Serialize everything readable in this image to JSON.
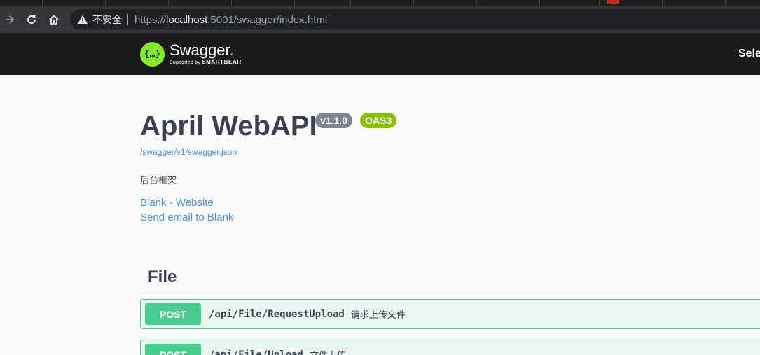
{
  "browser": {
    "insecure_label": "不安全",
    "url_scheme": "https",
    "url_sep": "://",
    "url_host": "localhost",
    "url_rest": ":5001/swagger/index.html"
  },
  "topbar": {
    "logo_glyph": "{…}",
    "logo_name": "Swagger",
    "logo_dot": ".",
    "logo_supported": "Supported by",
    "logo_brand": "SMARTBEAR",
    "select_label": "Sele"
  },
  "info": {
    "title": "April WebAPI",
    "version": "v1.1.0",
    "oas": "OAS3",
    "spec_url": "/swagger/v1/swagger.json",
    "description": "后台框架",
    "contact_website": "Blank - Website",
    "contact_email": "Send email to Blank"
  },
  "tags": [
    {
      "name": "File",
      "operations": [
        {
          "method": "POST",
          "path": "/api/File/RequestUpload",
          "summary": "请求上传文件"
        },
        {
          "method": "POST",
          "path": "/api/File/Upload",
          "summary": "文件上传"
        }
      ]
    }
  ],
  "colors": {
    "post": "#49cc90",
    "post_bg": "#e8f6f0",
    "link": "#4990e2",
    "topbar": "#1b1b1b",
    "logo": "#85ea2d"
  }
}
